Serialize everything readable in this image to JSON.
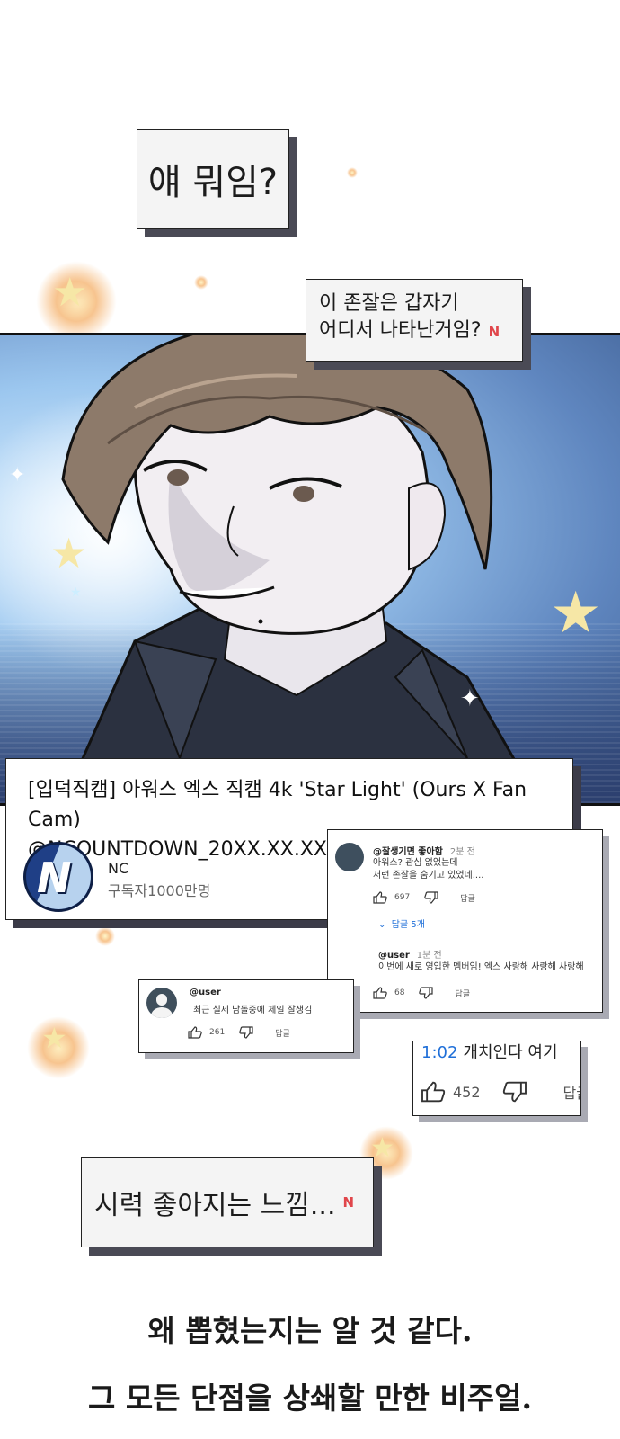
{
  "speech": {
    "bubble1": "얘 뭐임?",
    "bubble2_line1": "이 존잘은 갑자기",
    "bubble2_line2": "어디서 나타난거임?",
    "bubble3": "시력 좋아지는 느낌..."
  },
  "brand_mark": "N",
  "video": {
    "title_line1": "[입덕직캠] 아워스 엑스 직캠  4k 'Star Light' (Ours X Fan Cam)",
    "title_line2": "@NCOUNTDOWN_20XX.XX.XX",
    "channel_logo_letter": "N",
    "channel_name": "NC",
    "subscribers": "구독자1000만명"
  },
  "comments": {
    "top": {
      "user": "@잘생기면 좋아함",
      "time": "2분 전",
      "line1": "아워스? 관심 없었는데",
      "line2": "저런 존잘을 숨기고 있었네....",
      "likes": "697",
      "reply_label": "답글",
      "replies_toggle": "답글 5개"
    },
    "reply": {
      "user": "@user",
      "time": "1분 전",
      "text": "이번에 새로 영입한 멤버임! 엑스 사랑해 사랑해 사랑해",
      "likes": "68",
      "reply_label": "답글"
    },
    "second": {
      "user": "@user",
      "text": "최근 실세 남돌중에 제일 잘생김",
      "likes": "261",
      "reply_label": "답글"
    },
    "third": {
      "timestamp": "1:02",
      "text": "개치인다 여기",
      "likes": "452",
      "reply_label": "답글"
    }
  },
  "narration": {
    "line1": "왜 뽑혔는지는 알 것 같다.",
    "line2": "그 모든 단점을 상쇄할 만한 비주얼."
  },
  "colors": {
    "link_blue": "#1f6fd8",
    "brand_red": "#e0464b",
    "box_shadow": "#4a4a55"
  }
}
